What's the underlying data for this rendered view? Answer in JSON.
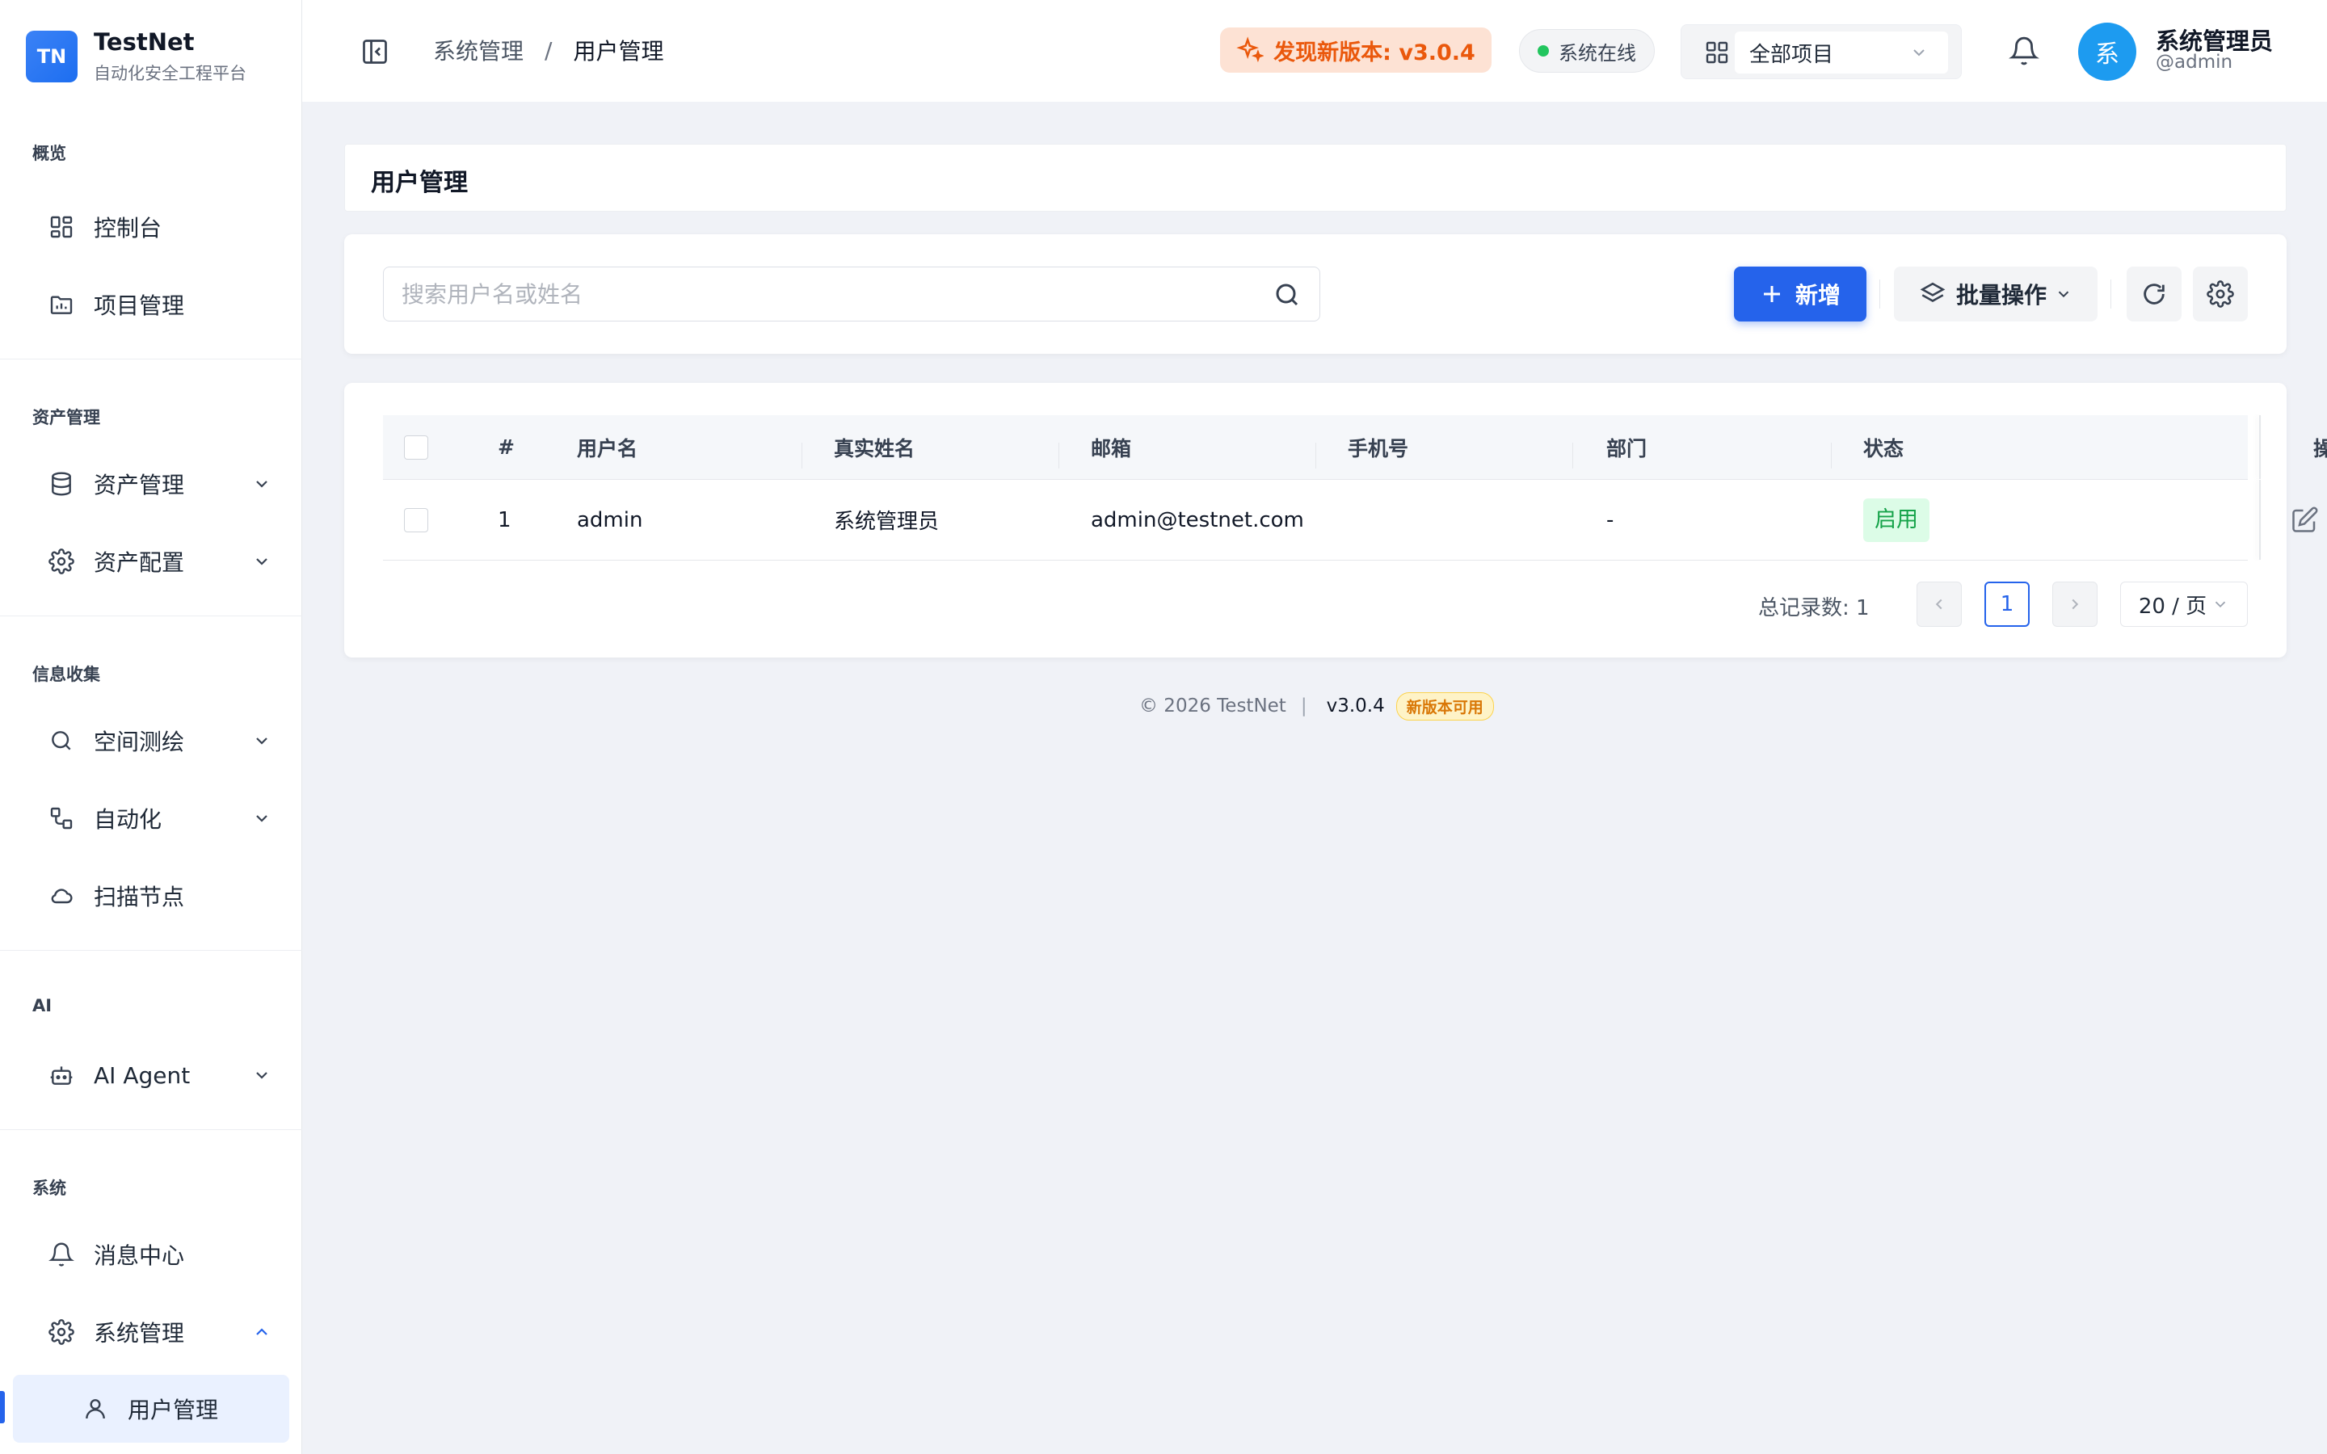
{
  "brand": {
    "logo_text": "TN",
    "name": "TestNet",
    "subtitle": "自动化安全工程平台"
  },
  "sidebar": {
    "sections": [
      {
        "label": "概览",
        "items": [
          {
            "label": "控制台",
            "icon": "dashboard-icon"
          },
          {
            "label": "项目管理",
            "icon": "folder-icon"
          }
        ]
      },
      {
        "label": "资产管理",
        "items": [
          {
            "label": "资产管理",
            "icon": "database-icon",
            "expandable": true
          },
          {
            "label": "资产配置",
            "icon": "gear-icon",
            "expandable": true
          }
        ]
      },
      {
        "label": "信息收集",
        "items": [
          {
            "label": "空间测绘",
            "icon": "search-icon",
            "expandable": true
          },
          {
            "label": "自动化",
            "icon": "workflow-icon",
            "expandable": true
          },
          {
            "label": "扫描节点",
            "icon": "cloud-icon"
          }
        ]
      },
      {
        "label": "AI",
        "items": [
          {
            "label": "AI Agent",
            "icon": "robot-icon",
            "expandable": true
          }
        ]
      },
      {
        "label": "系统",
        "items": [
          {
            "label": "消息中心",
            "icon": "bell-icon"
          },
          {
            "label": "系统管理",
            "icon": "gear-icon",
            "expandable": true,
            "expanded": true
          },
          {
            "label": "用户管理",
            "icon": "user-icon",
            "active": true
          }
        ]
      }
    ]
  },
  "header": {
    "breadcrumb": {
      "parent": "系统管理",
      "separator": "/",
      "current": "用户管理"
    },
    "update_notice": "发现新版本: v3.0.4",
    "status": "系统在线",
    "project_select": "全部项目",
    "user": {
      "avatar_text": "系",
      "name": "系统管理员",
      "handle": "@admin"
    }
  },
  "page": {
    "title": "用户管理"
  },
  "toolbar": {
    "search_placeholder": "搜索用户名或姓名",
    "search_value": "",
    "add_label": "新增",
    "batch_label": "批量操作"
  },
  "table": {
    "columns": [
      "#",
      "用户名",
      "真实姓名",
      "邮箱",
      "手机号",
      "部门",
      "状态",
      "操作"
    ],
    "rows": [
      {
        "index": "1",
        "username": "admin",
        "real_name": "系统管理员",
        "email": "admin@testnet.com",
        "phone": "",
        "department": "-",
        "status": "启用"
      }
    ]
  },
  "pagination": {
    "total_text": "总记录数: 1",
    "current_page": "1",
    "page_size": "20 / 页"
  },
  "footer": {
    "copyright": "© 2026 TestNet",
    "separator": "|",
    "version": "v3.0.4",
    "badge": "新版本可用"
  },
  "colors": {
    "primary": "#2563eb",
    "success": "#22c55e",
    "warning": "#ea580c",
    "sidebar_bg": "#ffffff",
    "page_bg": "#f0f2f7"
  }
}
